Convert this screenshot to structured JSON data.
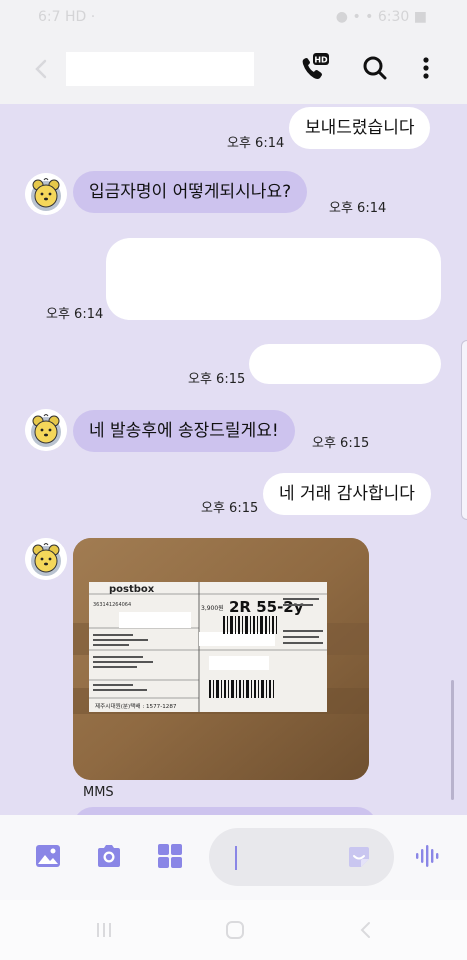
{
  "status_bar": {
    "left": "6:7 HD ·",
    "right": "● • • 6:30 ■"
  },
  "header": {
    "contact_name": ""
  },
  "messages": [
    {
      "dir": "out",
      "text": "보내드렸습니다",
      "time": "오후 6:14"
    },
    {
      "dir": "in",
      "text": "입금자명이 어떻게되시나요?",
      "time": "오후 6:14"
    },
    {
      "dir": "out",
      "text": "",
      "time": "오후 6:14"
    },
    {
      "dir": "out",
      "text": "",
      "time": "오후 6:15"
    },
    {
      "dir": "in",
      "text": "네 발송후에 송장드릴게요!",
      "time": "오후 6:15"
    },
    {
      "dir": "out",
      "text": "네 거래 감사합니다",
      "time": "오후 6:15"
    }
  ],
  "mms": {
    "label": "MMS",
    "label_text": {
      "brand": "postbox",
      "code": "2R 55-2y",
      "price": "3,900원",
      "phone": "제주시대원(분)택배 : 1577-1287",
      "tracking": "363141264064"
    }
  },
  "composer": {
    "placeholder": ""
  },
  "colors": {
    "incoming": "#cdc3ee",
    "outgoing": "#ffffff",
    "background": "#e3def3",
    "accent": "#8a86e6"
  }
}
